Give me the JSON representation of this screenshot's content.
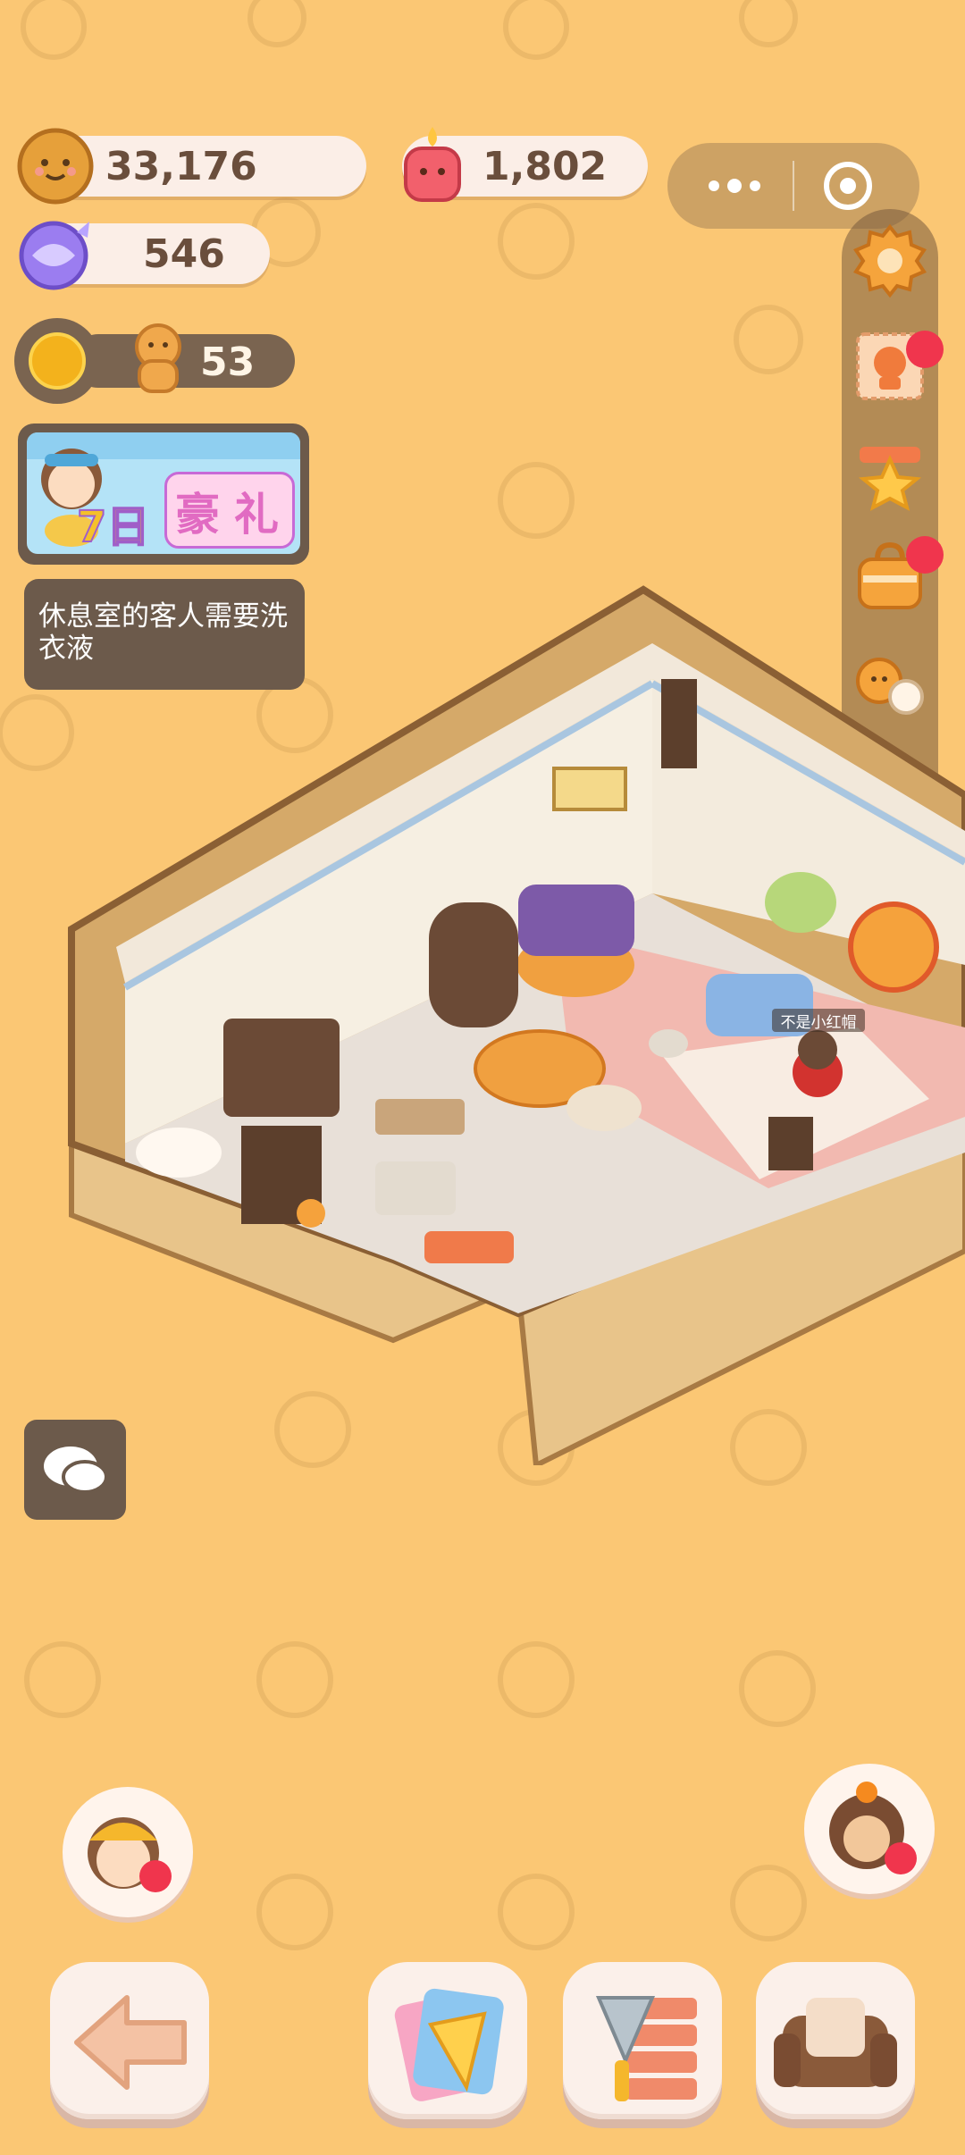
{
  "resources": {
    "coins": "33,176",
    "candles": "1,802",
    "gems": "546",
    "helpers": "53"
  },
  "promo": {
    "day": "7日",
    "text1": "豪",
    "text2": "礼"
  },
  "quest": {
    "text": "休息室的客人需要洗衣液"
  },
  "scene": {
    "character_name": "不是小红帽"
  },
  "icons": {
    "coin": "cookie-coin-icon",
    "candle": "red-candle-icon",
    "gem": "purple-candy-gem-icon",
    "sun": "sun-icon",
    "helper": "gingerbread-helper-icon",
    "settings": "gear-icon",
    "event": "stamp-card-icon",
    "shop": "star-shop-icon",
    "bag": "bag-icon",
    "friends": "friends-icon",
    "camera": "camera-icon",
    "chat": "chat-bubble-icon",
    "back": "back-arrow-icon",
    "catalog": "catalog-icon",
    "build": "trowel-bricks-icon",
    "furniture": "sofa-icon"
  },
  "colors": {
    "background": "#fbc774",
    "panel_dark": "#6c5a4b",
    "pill": "#fbeee7",
    "badge": "#f0354d"
  }
}
